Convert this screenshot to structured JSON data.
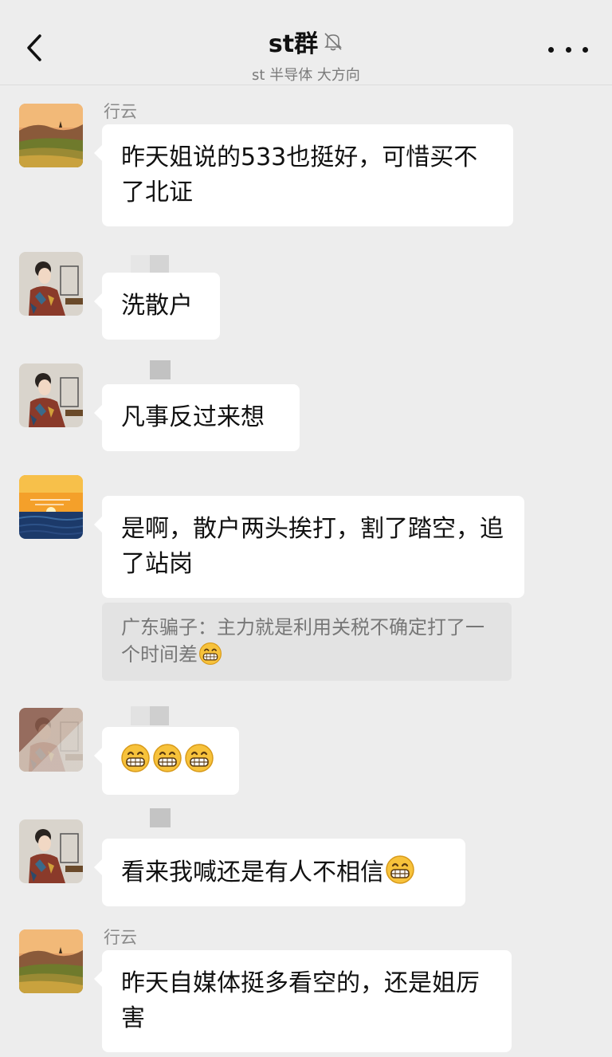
{
  "header": {
    "title": "st群",
    "subtitle": "st 半导体 大方向",
    "back_icon": "chevron-left-icon",
    "mute_icon": "bell-off-icon",
    "more_icon": "more-dots-icon"
  },
  "messages": [
    {
      "sender": "行云",
      "avatar": "landscape-avatar",
      "text": "昨天姐说的533也挺好，可惜买不了北证"
    },
    {
      "sender": "",
      "avatar": "lady-portrait-avatar",
      "text": "洗散户"
    },
    {
      "sender": "",
      "avatar": "lady-portrait-avatar",
      "text": "凡事反过来想"
    },
    {
      "sender": "",
      "avatar": "sunset-sea-avatar",
      "text": "是啊，散户两头挨打，割了踏空，追了站岗",
      "quote": "广东骗子：主力就是利用关税不确定打了一个时间差"
    },
    {
      "sender": "",
      "avatar": "lady-portrait-avatar",
      "text": "",
      "emoji_count": 3
    },
    {
      "sender": "",
      "avatar": "lady-portrait-avatar",
      "text": "看来我喊还是有人不相信"
    },
    {
      "sender": "行云",
      "avatar": "landscape-avatar",
      "text": "昨天自媒体挺多看空的，还是姐厉害"
    }
  ],
  "colors": {
    "background": "#ededed",
    "bubble": "#ffffff",
    "quote_bg": "#e3e3e3",
    "emoji": "#f7c23b"
  }
}
